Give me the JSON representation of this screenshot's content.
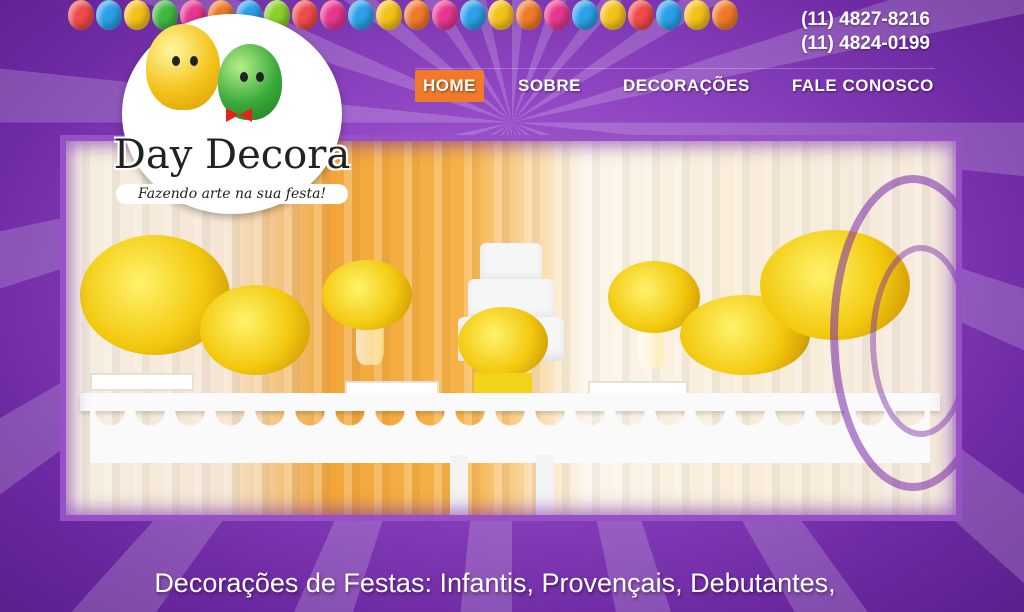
{
  "colors": {
    "background": "#8f45c2",
    "nav_active": "#f07a2a",
    "text": "#ffffff"
  },
  "balloons": [
    "#f04a4a",
    "#2aa0e8",
    "#f5c21a",
    "#42b843",
    "#e8368f",
    "#f07a2a",
    "#2aa0e8",
    "#8ad12b",
    "#f04a4a",
    "#e8368f",
    "#2aa0e8",
    "#f5c21a",
    "#f07a2a",
    "#e8368f",
    "#2aa0e8",
    "#f5c21a",
    "#f07a2a",
    "#e8368f",
    "#2aa0e8",
    "#f5c21a",
    "#f04a4a",
    "#2aa0e8",
    "#f5c21a",
    "#f07a2a"
  ],
  "header": {
    "phone_1": "(11) 4827-8216",
    "phone_2": "(11) 4824-0199"
  },
  "logo": {
    "name": "Day Decora",
    "tagline": "Fazendo arte na sua festa!"
  },
  "nav": {
    "items": [
      {
        "label": "HOME",
        "active": true
      },
      {
        "label": "SOBRE",
        "active": false
      },
      {
        "label": "DECORAÇÕES",
        "active": false
      },
      {
        "label": "FALE CONOSCO",
        "active": false
      }
    ]
  },
  "main": {
    "headline_line1": "Decorações de Festas: Infantis, Provençais, Debutantes,",
    "headline_line2": ""
  }
}
